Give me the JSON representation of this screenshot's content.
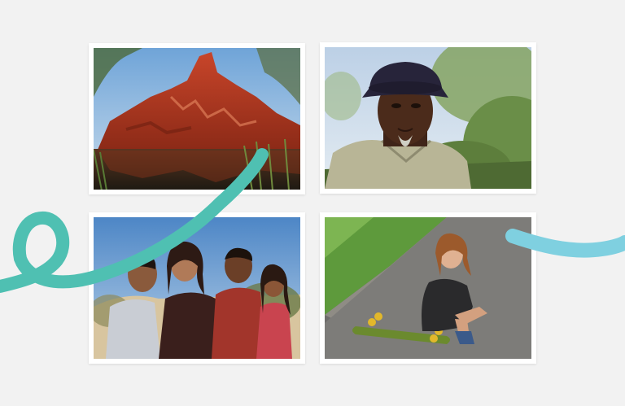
{
  "colors": {
    "background": "#f2f2f2",
    "card": "#ffffff",
    "ribbon_teal": "#4fc0b2",
    "ribbon_blue": "#7fd0e0"
  },
  "photos": [
    {
      "subject": "red-rock-gorge"
    },
    {
      "subject": "elder-portrait"
    },
    {
      "subject": "family-group"
    },
    {
      "subject": "skateboarder"
    }
  ]
}
